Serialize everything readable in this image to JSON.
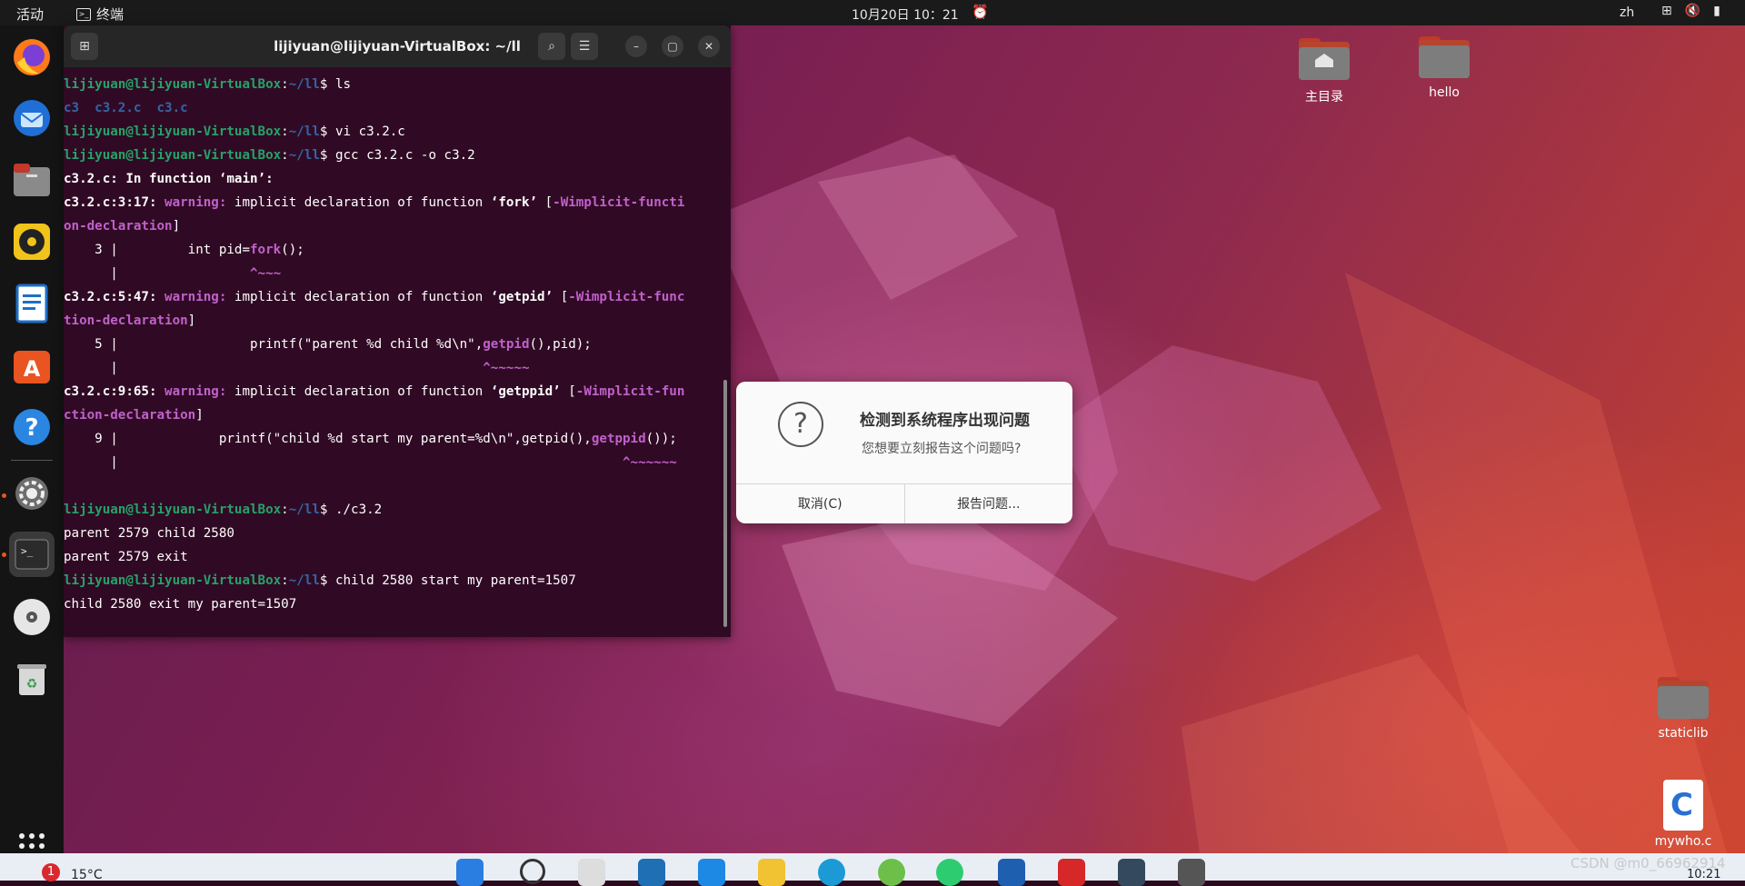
{
  "topbar": {
    "activities": "活动",
    "app_name": "终端",
    "clock": "10月20日  10：21",
    "lang": "zh"
  },
  "dock": {
    "items": [
      "firefox-icon",
      "thunderbird-icon",
      "files-icon",
      "rhythmbox-icon",
      "writer-icon",
      "software-icon",
      "help-icon",
      "settings-icon",
      "terminal-icon",
      "disc-icon",
      "trash-icon",
      "apps-grid-icon"
    ]
  },
  "terminal": {
    "title": "lijiyuan@lijiyuan-VirtualBox: ~/ll",
    "prompt_user": "lijiyuan@lijiyuan-VirtualBox",
    "prompt_path": "~/ll",
    "lines": {
      "l1_cmd": " ls",
      "l2": "c3  c3.2.c  c3.c",
      "l3_cmd": " vi c3.2.c",
      "l4_cmd": " gcc c3.2.c -o c3.2",
      "l5": "c3.2.c: In function ‘main’:",
      "w1_loc": "c3.2.c:3:17:",
      "w1_text": " implicit declaration of function ",
      "w1_fn": "‘fork’",
      "w1_flag_a": "-Wimplicit-functi",
      "w1_flag_b": "on-declaration",
      "c1_line": "    3 |         int pid=",
      "c1_hl": "fork",
      "c1_rest": "();",
      "c1_caret_pre": "      |                 ",
      "c1_caret": "^~~~",
      "w2_loc": "c3.2.c:5:47:",
      "w2_text": " implicit declaration of function ",
      "w2_fn": "‘getpid’",
      "w2_flag_a": "-Wimplicit-func",
      "w2_flag_b": "tion-declaration",
      "c2_line": "    5 |                 printf(\"parent %d child %d\\n\",",
      "c2_hl": "getpid",
      "c2_rest": "(),pid);",
      "c2_caret_pre": "      |                                               ",
      "c2_caret": "^~~~~~",
      "w3_loc": "c3.2.c:9:65:",
      "w3_text": " implicit declaration of function ",
      "w3_fn": "‘getppid’",
      "w3_flag_a": "-Wimplicit-fun",
      "w3_flag_b": "ction-declaration",
      "c3_line": "    9 |             printf(\"child %d start my parent=%d\\n\",getpid(),",
      "c3_hl": "getppid",
      "c3_rest": "());",
      "c3_caret_pre": "      |                                                                 ",
      "c3_caret": "^~~~~~~",
      "c3_bar": "      |",
      "warning": "warning:",
      "l_run_cmd": " ./c3.2",
      "out1": "parent 2579 child 2580",
      "out2": "parent 2579 exit",
      "out3_cmd": " child 2580 start my parent=1507",
      "out4": "child 2580 exit my parent=1507"
    }
  },
  "dialog": {
    "title": "检测到系统程序出现问题",
    "message": "您想要立刻报告这个问题吗?",
    "cancel": "取消(C)",
    "report": "报告问题..."
  },
  "desktop_icons": {
    "home": "主目录",
    "hello": "hello",
    "staticlib": "staticlib",
    "mywho": "mywho.c"
  },
  "taskbar": {
    "badge": "1",
    "weather": "15°C",
    "time": "10:21"
  },
  "watermark": "CSDN @m0_66962914",
  "colors": {
    "accent": "#e95420",
    "term_bg": "#300a24",
    "prompt_green": "#26a269",
    "prompt_blue": "#3465a4",
    "warn_magenta": "#c061cb"
  }
}
